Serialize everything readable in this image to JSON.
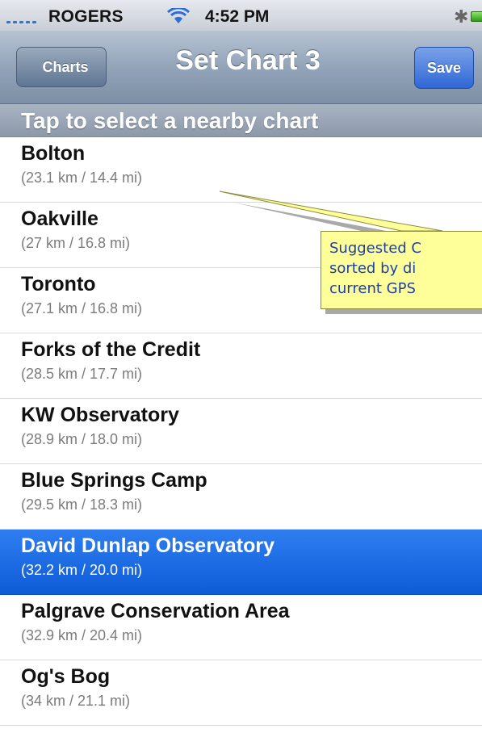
{
  "status_bar": {
    "carrier": "ROGERS",
    "time": "4:52 PM",
    "bluetooth_icon": "bluetooth-icon",
    "wifi_icon": "wifi-icon",
    "battery_icon": "battery-icon"
  },
  "nav": {
    "back_label": "Charts",
    "title": "Set Chart 3",
    "save_label": "Save"
  },
  "section_header": "Tap to select a nearby chart",
  "charts": [
    {
      "name": "Bolton",
      "distance": "(23.1 km / 14.4 mi)",
      "selected": false
    },
    {
      "name": "Oakville",
      "distance": "(27 km / 16.8 mi)",
      "selected": false
    },
    {
      "name": "Toronto",
      "distance": "(27.1 km / 16.8 mi)",
      "selected": false
    },
    {
      "name": "Forks of the Credit",
      "distance": "(28.5 km / 17.7 mi)",
      "selected": false
    },
    {
      "name": "KW Observatory",
      "distance": "(28.9 km / 18.0 mi)",
      "selected": false
    },
    {
      "name": "Blue Springs Camp",
      "distance": "(29.5 km / 18.3 mi)",
      "selected": false
    },
    {
      "name": "David Dunlap Observatory",
      "distance": "(32.2 km / 20.0 mi)",
      "selected": true
    },
    {
      "name": "Palgrave Conservation Area",
      "distance": "(32.9 km / 20.4 mi)",
      "selected": false
    },
    {
      "name": "Og's Bog",
      "distance": "(34 km / 21.1 mi)",
      "selected": false
    }
  ],
  "callout": {
    "lines": [
      "Suggested C",
      "sorted by di",
      "current GPS"
    ]
  },
  "colors": {
    "selection": "#1a67e3",
    "callout_fill": "#ffff99",
    "callout_text": "#1f3fa8"
  }
}
